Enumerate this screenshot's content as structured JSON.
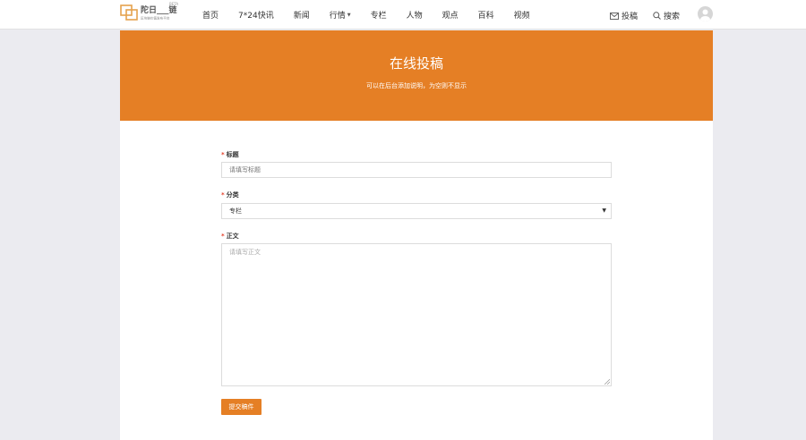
{
  "logo": {
    "wordmark": "陀日___链",
    "beta": "BETA",
    "slogan": "区块链价值发布平台"
  },
  "nav": {
    "items": [
      {
        "label": "首页"
      },
      {
        "label": "7*24快讯"
      },
      {
        "label": "新闻"
      },
      {
        "label": "行情",
        "has_dropdown": true
      },
      {
        "label": "专栏"
      },
      {
        "label": "人物"
      },
      {
        "label": "观点"
      },
      {
        "label": "百科"
      },
      {
        "label": "视频"
      }
    ]
  },
  "actions": {
    "submit_label": "投稿",
    "search_label": "搜索"
  },
  "banner": {
    "title": "在线投稿",
    "subtitle": "可以在后台添加说明，为空则不显示",
    "color": "#e57f25"
  },
  "form": {
    "title": {
      "label": "标题",
      "placeholder": "请填写标题",
      "required_mark": "*"
    },
    "category": {
      "label": "分类",
      "value": "专栏",
      "required_mark": "*"
    },
    "body": {
      "label": "正文",
      "placeholder": "请填写正文",
      "required_mark": "*"
    },
    "submit_label": "提交稿件"
  }
}
